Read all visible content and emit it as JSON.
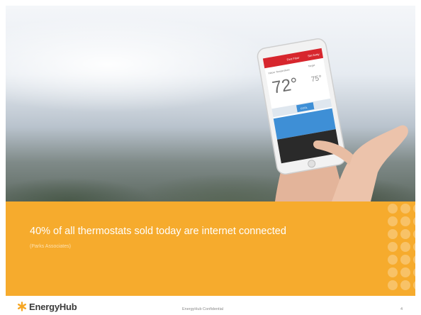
{
  "slide": {
    "headline": "40% of all thermostats sold today are internet connected",
    "source": "(Parks Associates)"
  },
  "phone": {
    "header_left": "First Floor",
    "header_right": "Set Away",
    "indoor_label": "Indoor Temperature",
    "target_label": "Target",
    "temperature": "72°",
    "target_value": "75°",
    "mode_button": "COOL"
  },
  "footer": {
    "logo_text": "EnergyHub",
    "confidential": "EnergyHub Confidential",
    "page_number": "4"
  },
  "colors": {
    "accent_orange": "#f6ab2d",
    "app_red": "#d7262d"
  }
}
